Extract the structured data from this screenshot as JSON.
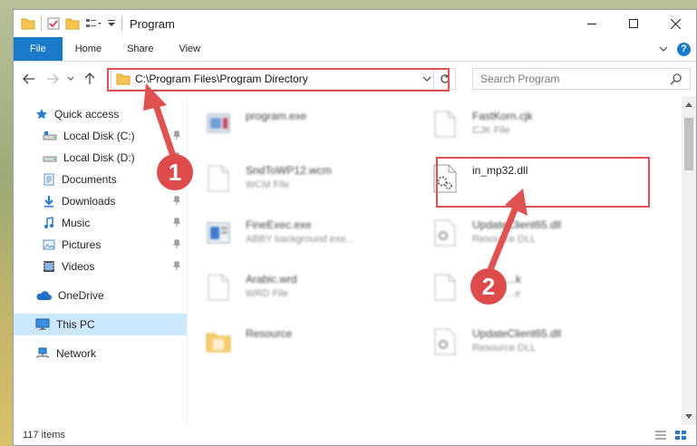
{
  "window": {
    "title": "Program",
    "controls": {
      "minimize": "minimize-icon",
      "maximize": "maximize-icon",
      "close": "close-icon"
    }
  },
  "ribbon": {
    "tabs": [
      {
        "label": "File"
      },
      {
        "label": "Home"
      },
      {
        "label": "Share"
      },
      {
        "label": "View"
      }
    ],
    "help": "?"
  },
  "address": {
    "path": "C:\\Program Files\\Program Directory"
  },
  "search": {
    "placeholder": "Search Program"
  },
  "sidebar": {
    "quick_access": "Quick access",
    "items": [
      {
        "label": "Local Disk (C:)",
        "icon": "drive-icon",
        "pinned": true
      },
      {
        "label": "Local Disk (D:)",
        "icon": "drive-icon",
        "pinned": true
      },
      {
        "label": "Documents",
        "icon": "documents-icon",
        "pinned": false
      },
      {
        "label": "Downloads",
        "icon": "downloads-icon",
        "pinned": true
      },
      {
        "label": "Music",
        "icon": "music-icon",
        "pinned": true
      },
      {
        "label": "Pictures",
        "icon": "pictures-icon",
        "pinned": true
      },
      {
        "label": "Videos",
        "icon": "videos-icon",
        "pinned": true
      }
    ],
    "onedrive": "OneDrive",
    "this_pc": "This PC",
    "network": "Network"
  },
  "files": [
    {
      "name": "program.exe",
      "type": "",
      "icon": "exe-icon"
    },
    {
      "name": "FastKorn.cjk",
      "type": "CJK File",
      "icon": "file-icon"
    },
    {
      "name": "SndToWP12.wcm",
      "type": "WCM File",
      "icon": "file-icon"
    },
    {
      "name": "in_mp32.dll",
      "type": "",
      "icon": "dll-icon"
    },
    {
      "name": "FineExec.exe",
      "type": "ABBY background exe...",
      "icon": "exe-icon"
    },
    {
      "name": "UpdateClient65.dll",
      "type": "Resource DLL",
      "icon": "dll-icon"
    },
    {
      "name": "Arabic.wrd",
      "type": "WRD File",
      "icon": "file-icon"
    },
    {
      "name": "...k",
      "type": "...e",
      "icon": "file-icon"
    },
    {
      "name": "Resource",
      "type": "",
      "icon": "folder-icon"
    },
    {
      "name": "UpdateClient65.dll",
      "type": "Resource DLL",
      "icon": "dll-icon"
    }
  ],
  "status": {
    "count": "117 items"
  },
  "annotations": {
    "step1": "1",
    "step2": "2"
  },
  "colors": {
    "accent": "#1979ca",
    "annotation": "#dd4b4b",
    "selected": "#cce8ff"
  }
}
